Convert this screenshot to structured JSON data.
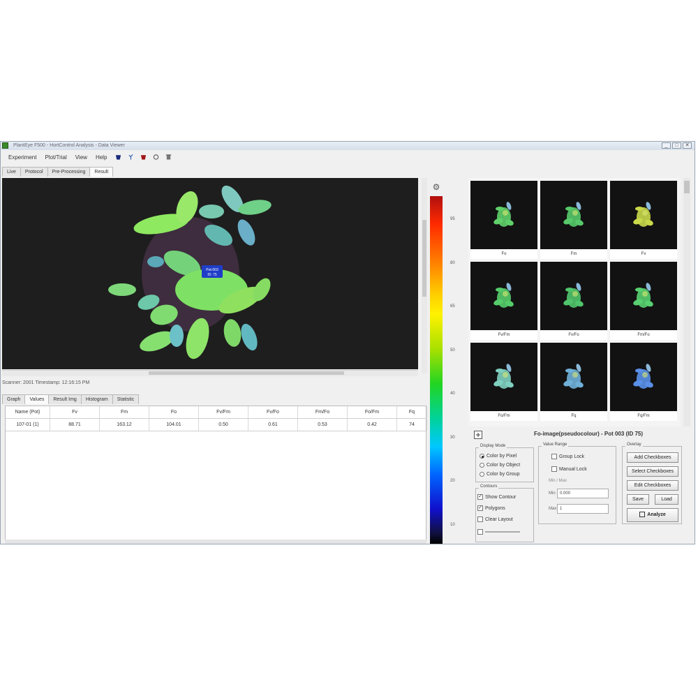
{
  "window": {
    "title": "PlantEye F500 - HortControl Analysis - Data Viewer",
    "controls": [
      "_",
      "□",
      "✕"
    ]
  },
  "menu": [
    "Experiment",
    "Plot/Trial",
    "View",
    "Help"
  ],
  "toolbar_icons": [
    "pot-icon",
    "plant-icon",
    "red-pot-icon",
    "circle-icon",
    "trash-icon"
  ],
  "tabs_top": [
    "Live",
    "Protocol",
    "Pre-Processing",
    "Result"
  ],
  "tabs_top_active": 3,
  "image_overlay": {
    "line1": "Pot-003",
    "line2": "ID: 75"
  },
  "info_bar": "Scanner: 2001    Timestamp: 12:16:15 PM",
  "tabs_data": [
    "Graph",
    "Values",
    "Result Img",
    "Histogram",
    "Statistic"
  ],
  "tabs_data_active": 1,
  "table": {
    "headers": [
      "Name (Pot)",
      "Fv",
      "Fm",
      "Fo",
      "Fv/Fm",
      "Fv/Fo",
      "Fm/Fo",
      "Fo/Fm",
      "Fq"
    ],
    "rows": [
      [
        "107-01 (1)",
        "88.71",
        "163.12",
        "104.01",
        "0.50",
        "0.61",
        "0.53",
        "0.42",
        "74"
      ]
    ]
  },
  "colorbar": {
    "ticks": [
      "95",
      "80",
      "65",
      "50",
      "40",
      "30",
      "20",
      "10"
    ],
    "colors": [
      "#b01010",
      "#ff7700",
      "#fff200",
      "#22d522",
      "#00c8ff",
      "#0066ff",
      "#101040"
    ]
  },
  "thumbnails": {
    "labels": [
      "Fo",
      "Fm",
      "Fv",
      "Fv/Fm",
      "Fv/Fo",
      "Fm/Fo",
      "Fo/Fm",
      "Fq",
      "Fq/Fm"
    ],
    "tints": [
      "#5fd06a",
      "#57c96a",
      "#c9d84a",
      "#55cc6a",
      "#50c46c",
      "#58d070",
      "#7fd0c0",
      "#6fb0d8",
      "#5a90e8"
    ]
  },
  "panel_title": "Fo-image(pseudocolour) - Pot 003 (ID 75)",
  "display_mode": {
    "title": "Display Mode",
    "options": [
      "Color by Pixel",
      "Color by Object",
      "Color by Group"
    ],
    "selected": 0
  },
  "value_range": {
    "title": "Value Range",
    "checks": [
      "Group Lock",
      "Manual Lock"
    ],
    "scale_label": "Min / Max",
    "min_label": "Min",
    "min_value": "0.000",
    "max_label": "Max",
    "max_value": "1"
  },
  "contours": {
    "title": "Contours",
    "items": [
      {
        "label": "Show Contour",
        "checked": true
      },
      {
        "label": "Polygons",
        "checked": true
      },
      {
        "label": "Clear Layout",
        "checked": false
      }
    ]
  },
  "overlay_group": {
    "title": "Overlay",
    "buttons": [
      "Add Checkboxes",
      "Select Checkboxes",
      "Edit Checkboxes"
    ],
    "save": "Save",
    "load": "Load",
    "analyze": "Analyze"
  }
}
